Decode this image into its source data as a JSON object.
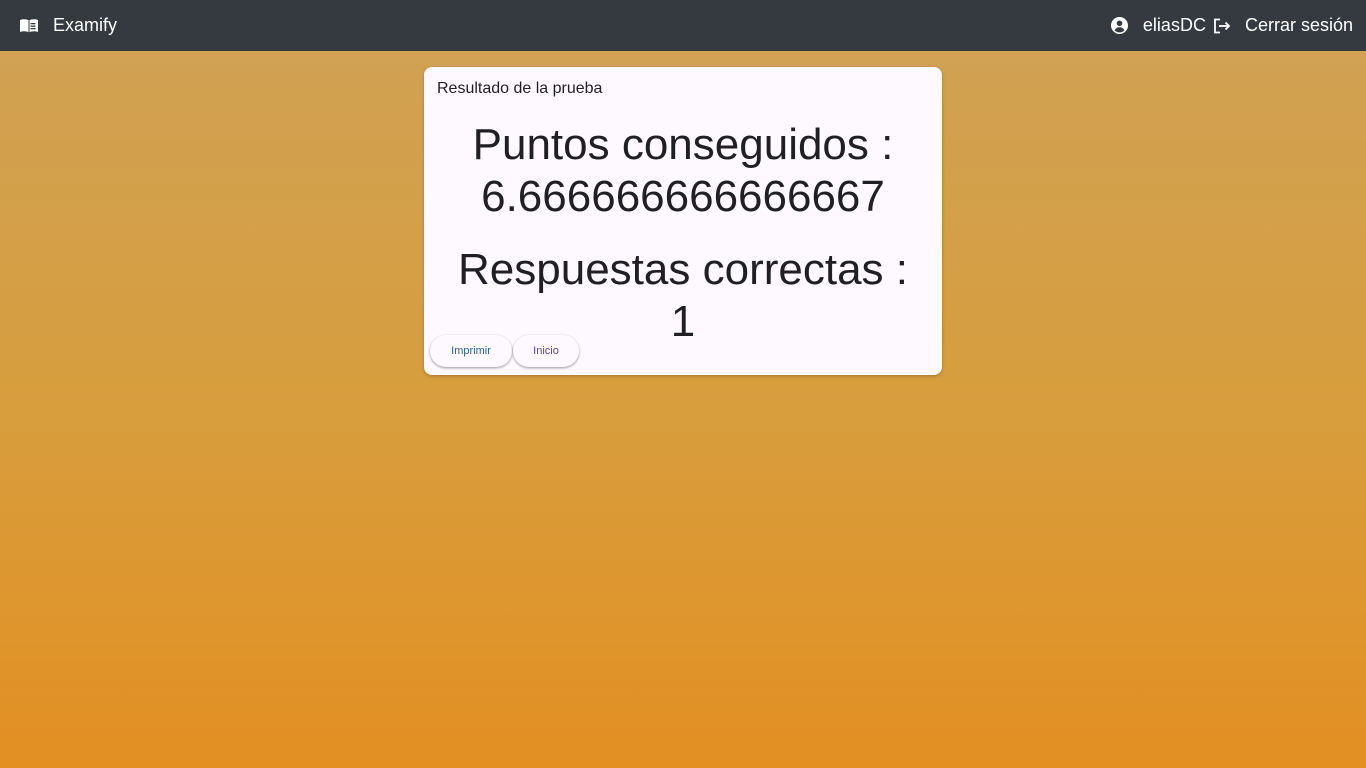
{
  "header": {
    "app_name": "Examify",
    "username": "eliasDC",
    "logout_label": "Cerrar sesión",
    "icons": {
      "brand": "book-icon",
      "account": "account-circle-icon",
      "logout": "logout-icon"
    },
    "background_color": "#343a40"
  },
  "result_card": {
    "title": "Resultado de la prueba",
    "points_label": "Puntos conseguidos :",
    "points_value": "6.666666666666667",
    "correct_label": "Respuestas correctas :",
    "correct_value": "1",
    "print_button": "Imprimir",
    "home_button": "Inicio"
  },
  "colors": {
    "background_top": "#cfa256",
    "background_bottom": "#e38f22",
    "card": "#fdf9ff",
    "print_text": "#2b5c8a",
    "home_text": "#5b3fb0"
  }
}
